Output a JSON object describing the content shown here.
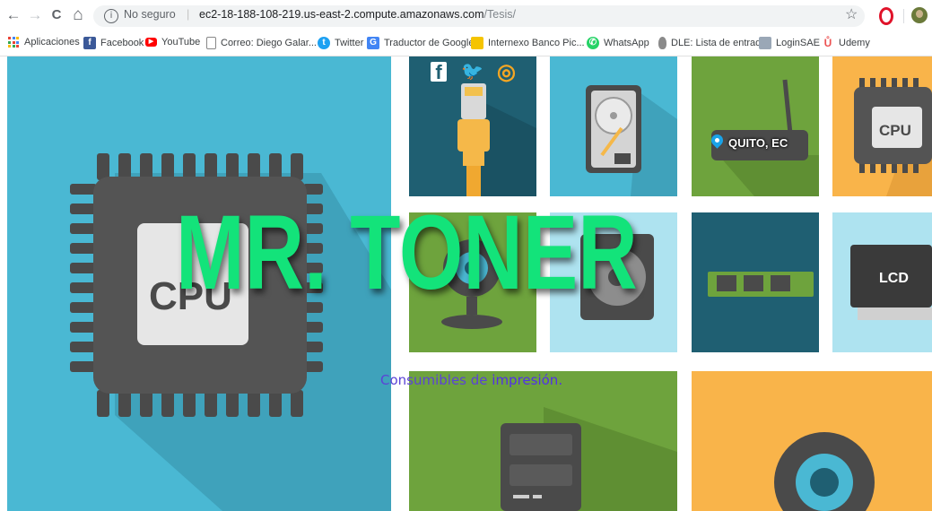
{
  "browser": {
    "nav": {
      "back": "←",
      "forward": "→",
      "reload": "C",
      "home": "⌂"
    },
    "security_label": "No seguro",
    "separator": "|",
    "url_host": "ec2-18-188-108-219.us-east-2.compute.amazonaws.com",
    "url_path": "/Tesis/",
    "bookmark_star": "☆"
  },
  "bookmarks": [
    {
      "label": "Aplicaciones",
      "icon": "apps-icon"
    },
    {
      "label": "Facebook",
      "icon": "facebook-icon",
      "color": "#3b5998",
      "glyph": "f"
    },
    {
      "label": "YouTube",
      "icon": "youtube-icon",
      "color": "#ff0000",
      "glyph": "▶"
    },
    {
      "label": "Correo: Diego Galar...",
      "icon": "page-icon",
      "color": "#ffffff",
      "glyph": ""
    },
    {
      "label": "Twitter",
      "icon": "twitter-icon",
      "color": "#1da1f2",
      "glyph": "t"
    },
    {
      "label": "Traductor de Google",
      "icon": "translate-icon",
      "color": "#4285f4",
      "glyph": "G"
    },
    {
      "label": "Internexo Banco Pic...",
      "icon": "bank-icon",
      "color": "#f5c400",
      "glyph": ""
    },
    {
      "label": "WhatsApp",
      "icon": "whatsapp-icon",
      "color": "#25d366",
      "glyph": "✆"
    },
    {
      "label": "DLE: Lista de entrad...",
      "icon": "dle-icon",
      "color": "#8a8a8a",
      "glyph": ""
    },
    {
      "label": "LoginSAE",
      "icon": "login-icon",
      "color": "#9aa7b6",
      "glyph": ""
    },
    {
      "label": "Udemy",
      "icon": "udemy-icon",
      "color": "#ec5252",
      "glyph": "Ů"
    }
  ],
  "site": {
    "title": "MR. TONER",
    "subtitle_start": "Consumibles de ",
    "subtitle_end": "impresión.",
    "location": "QUITO, EC",
    "social": {
      "facebook": "f",
      "twitter": "🐦",
      "instagram": "◎"
    },
    "labels": {
      "cpu": "CPU",
      "lcd": "LCD"
    }
  },
  "colors": {
    "accent_green": "#13e37a",
    "sky_blue": "#4ab8d3",
    "dark_teal": "#1f5f72",
    "olive": "#6ea33d",
    "orange": "#f9b44a",
    "light_blue": "#aee3f0",
    "subtitle": "#5b43d6"
  }
}
